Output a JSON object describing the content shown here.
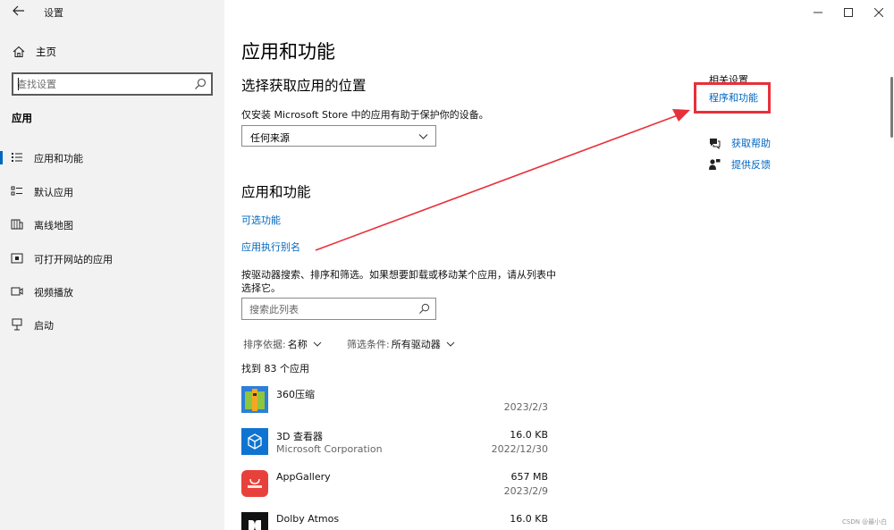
{
  "window": {
    "title": "设置",
    "controls": [
      "minimize",
      "maximize",
      "close"
    ]
  },
  "sidebar": {
    "home_label": "主页",
    "search_placeholder": "查找设置",
    "section_title": "应用",
    "items": [
      {
        "label": "应用和功能",
        "icon": "apps-features-icon",
        "selected": true
      },
      {
        "label": "默认应用",
        "icon": "default-apps-icon",
        "selected": false
      },
      {
        "label": "离线地图",
        "icon": "offline-maps-icon",
        "selected": false
      },
      {
        "label": "可打开网站的应用",
        "icon": "apps-for-websites-icon",
        "selected": false
      },
      {
        "label": "视频播放",
        "icon": "video-playback-icon",
        "selected": false
      },
      {
        "label": "启动",
        "icon": "startup-icon",
        "selected": false
      }
    ]
  },
  "main": {
    "page_title": "应用和功能",
    "choose_heading": "选择获取应用的位置",
    "choose_desc": "仅安装 Microsoft Store 中的应用有助于保护你的设备。",
    "source_value": "任何来源",
    "apps_heading": "应用和功能",
    "optional_features_link": "可选功能",
    "aliases_link": "应用执行别名",
    "list_desc_line1": "按驱动器搜索、排序和筛选。如果想要卸载或移动某个应用，请从列表中",
    "list_desc_line2": "选择它。",
    "list_search_placeholder": "搜索此列表",
    "sort_label": "排序依据:",
    "sort_value": "名称",
    "filter_label": "筛选条件:",
    "filter_value": "所有驱动器",
    "count_text": "找到 83 个应用",
    "apps": [
      {
        "name": "360压缩",
        "publisher": "",
        "size": "",
        "date": "2023/2/3",
        "icon": "archive-app-icon"
      },
      {
        "name": "3D 查看器",
        "publisher": "Microsoft Corporation",
        "size": "16.0 KB",
        "date": "2022/12/30",
        "icon": "3d-viewer-icon"
      },
      {
        "name": "AppGallery",
        "publisher": "",
        "size": "657 MB",
        "date": "2023/2/9",
        "icon": "appgallery-icon"
      },
      {
        "name": "Dolby Atmos",
        "publisher": "",
        "size": "16.0 KB",
        "date": "",
        "icon": "dolby-icon"
      }
    ]
  },
  "related": {
    "heading": "相关设置",
    "programs_link": "程序和功能",
    "help_link": "获取帮助",
    "feedback_link": "提供反馈"
  },
  "colors": {
    "accent": "#0067c0",
    "highlight_box": "#e8303a",
    "sidebar_bg": "#f2f2f2"
  },
  "watermark": "CSDN @最小白"
}
